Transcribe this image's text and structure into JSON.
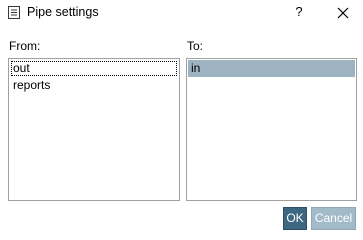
{
  "window": {
    "title": "Pipe settings",
    "help_label": "?",
    "icon": "document-list-icon",
    "close_icon": "close-icon"
  },
  "from": {
    "label": "From:",
    "items": [
      "out",
      "reports"
    ],
    "focused_item": "out"
  },
  "to": {
    "label": "To:",
    "items": [
      "in"
    ],
    "selected_item": "in"
  },
  "buttons": {
    "ok_label": "OK",
    "cancel_label": "Cancel"
  },
  "colors": {
    "selection": "#9eb3c2",
    "ok_button": "#3d6680",
    "cancel_button_disabled": "#a3bac9"
  }
}
